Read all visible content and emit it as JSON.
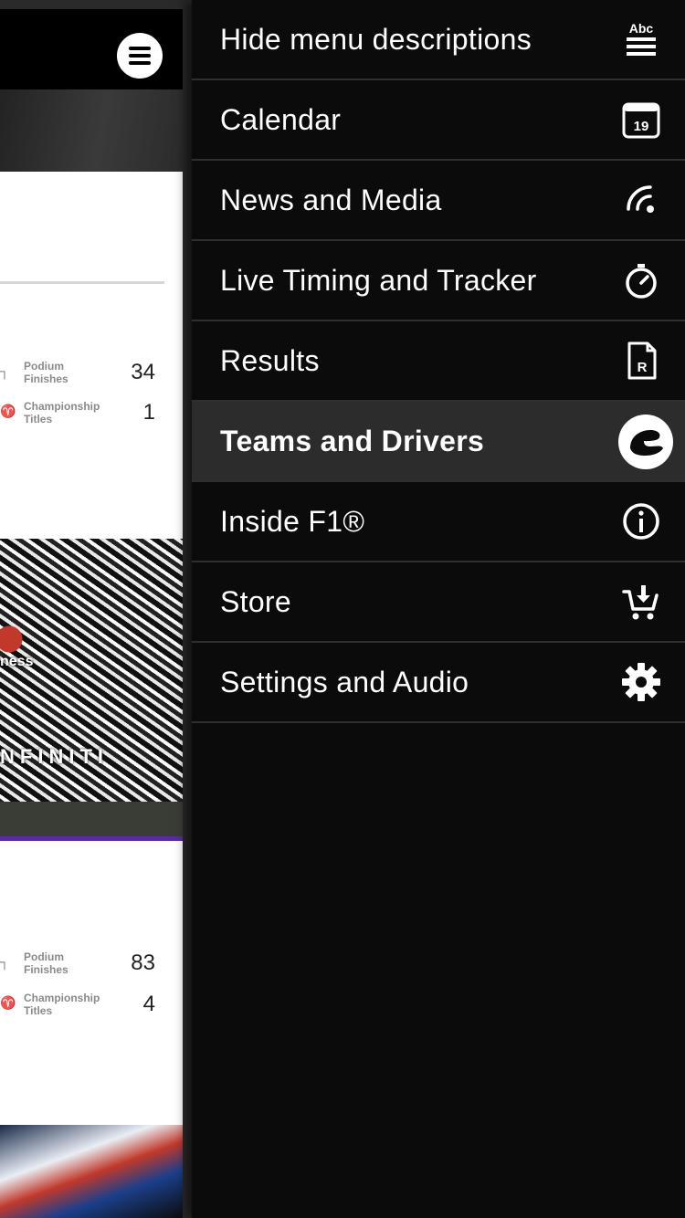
{
  "background": {
    "card1": {
      "stats": [
        {
          "label": "Podium Finishes",
          "value": "34"
        },
        {
          "label": "Championship Titles",
          "value": "1"
        }
      ]
    },
    "card2": {
      "stats": [
        {
          "label": "Podium Finishes",
          "value": "83"
        },
        {
          "label": "Championship Titles",
          "value": "4"
        }
      ]
    },
    "photo1": {
      "sponsor_text": "ness",
      "car_text": "NFINITI"
    }
  },
  "menu": {
    "items": [
      {
        "label": "Hide menu descriptions",
        "icon": "abc-lines-icon",
        "active": false
      },
      {
        "label": "Calendar",
        "icon": "calendar-icon",
        "icon_text": "19",
        "active": false
      },
      {
        "label": "News and Media",
        "icon": "broadcast-icon",
        "active": false
      },
      {
        "label": "Live Timing and Tracker",
        "icon": "stopwatch-icon",
        "active": false
      },
      {
        "label": "Results",
        "icon": "results-document-icon",
        "icon_text": "R",
        "active": false
      },
      {
        "label": "Teams and Drivers",
        "icon": "helmet-icon",
        "active": true
      },
      {
        "label": "Inside F1®",
        "icon": "info-icon",
        "active": false
      },
      {
        "label": "Store",
        "icon": "cart-icon",
        "active": false
      },
      {
        "label": "Settings and Audio",
        "icon": "gear-icon",
        "active": false
      }
    ],
    "abc_icon_text": "Abc",
    "active_color": "#2c2c2c"
  }
}
